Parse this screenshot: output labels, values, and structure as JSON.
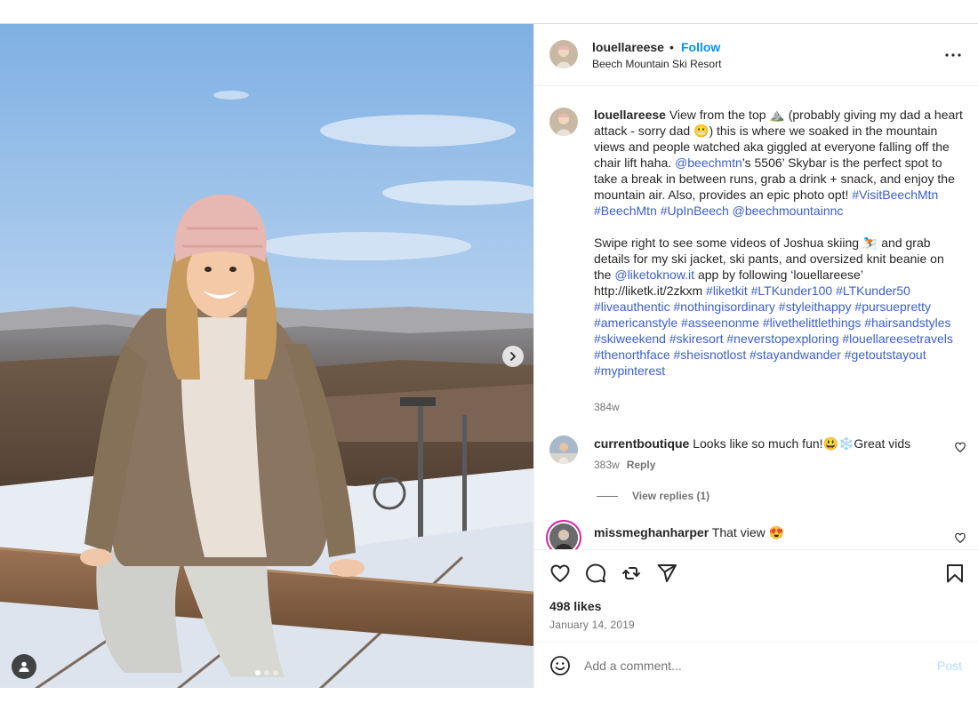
{
  "post": {
    "username": "louellareese",
    "separator": "•",
    "follow_label": "Follow",
    "location": "Beech Mountain Ski Resort",
    "more_icon": "more-horizontal-icon"
  },
  "media": {
    "carousel": {
      "current": 1,
      "total": 3
    },
    "next_icon": "chevron-right-icon",
    "tag_icon": "user-tag-icon"
  },
  "caption": {
    "username": "louellareese",
    "p1_seg1": " View from the top ⛰️ (probably giving my dad a heart attack - sorry dad 😬) this is where we soaked in the mountain views and people watched aka giggled at everyone falling off the chair lift haha. ",
    "mention_beechmtn": "@beechmtn",
    "p1_seg2": "’s 5506’ Skybar is the perfect spot to take a break in between runs, grab a drink + snack, and enjoy the mountain air. Also, provides an epic photo opt! ",
    "p1_tags": "#VisitBeechMtn #BeechMtn #UpInBeech @beechmountainnc",
    "p2_seg1": "Swipe right to see some videos of Joshua skiing ⛷️ and grab details for my ski jacket, ski pants, and oversized knit beanie on the ",
    "mention_liketoknow": "@liketoknow.it",
    "p2_seg2": " app by following ‘louellareese’ http://liketk.it/2zkxm ",
    "p2_tags": "#liketkit #LTKunder100 #LTKunder50 #liveauthentic #nothingisordinary #styleithappy #pursuepretty #americanstyle #asseenonme #livethelittlethings #hairsandstyles #skiweekend #skiresort #neverstopexploring #louellareesetravels #thenorthface #sheisnotlost #stayandwander #getoutstayout #mypinterest",
    "time": "384w"
  },
  "comments": [
    {
      "username": "currentboutique",
      "text": " Looks like so much fun!😃❄️Great vids",
      "time": "383w",
      "reply_label": "Reply",
      "view_replies": "View replies (1)"
    },
    {
      "username": "missmeghanharper",
      "text": " That view 😍"
    }
  ],
  "actions": {
    "like_icon": "heart-icon",
    "comment_icon": "comment-icon",
    "repost_icon": "repost-icon",
    "share_icon": "share-icon",
    "save_icon": "bookmark-icon",
    "likes": "498 likes",
    "date": "January 14, 2019"
  },
  "composer": {
    "placeholder": "Add a comment...",
    "post_label": "Post",
    "emoji_icon": "emoji-icon"
  },
  "colors": {
    "link": "#3b5ecf",
    "follow": "#0095f6",
    "muted": "#737373",
    "post_disabled": "#b2dffc",
    "story_ring": "#d6249f"
  }
}
